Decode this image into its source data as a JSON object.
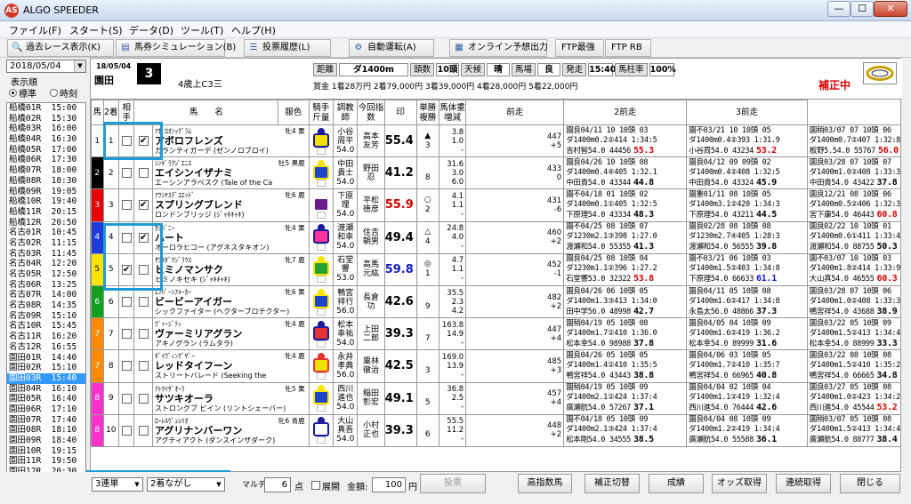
{
  "app": {
    "title": "ALGO SPEEDER",
    "logo": "AS"
  },
  "window": {
    "min": "—",
    "max": "☐",
    "close": "✕"
  },
  "menu": [
    "ファイル(F)",
    "スタート(S)",
    "データ(D)",
    "ツール(T)",
    "ヘルプ(H)"
  ],
  "toolbar": [
    {
      "label": "過去レース表示(K)",
      "icon": "search-icon"
    },
    {
      "label": "馬券シミュレーション(B)",
      "icon": "ticket-icon"
    },
    {
      "label": "投票履歴(L)",
      "icon": "list-icon"
    },
    {
      "label": "自動運転(A)",
      "icon": "gear-icon"
    },
    {
      "label": "オンライン予想出力",
      "icon": "output-icon"
    },
    {
      "label": "FTP最強"
    },
    {
      "label": "FTP RB"
    }
  ],
  "left": {
    "date": "2018/05/04",
    "order_label": "表示順",
    "radio": [
      {
        "label": "標準",
        "checked": true
      },
      {
        "label": "時刻",
        "checked": false
      }
    ],
    "races": [
      "船橋01R  15:00",
      "船橋02R  15:30",
      "船橋03R  16:00",
      "船橋04R  16:30",
      "船橋05R  17:00",
      "船橋06R  17:30",
      "船橋07R  18:00",
      "船橋08R  18:30",
      "船橋09R  19:05",
      "船橋10R  19:40",
      "船橋11R  20:15",
      "船橋12R  20:50",
      "名古01R  10:45",
      "名古02R  11:15",
      "名古03R  11:45",
      "名古04R  12:20",
      "名古05R  12:50",
      "名古06R  13:25",
      "名古07R  14:00",
      "名古08R  14:35",
      "名古09R  15:10",
      "名古10R  15:45",
      "名古11R  16:20",
      "名古12R  16:55",
      "園田01R  14:40",
      "園田02R  15:10",
      "園田03R  15:40",
      "園田04R  16:10",
      "園田05R  16:40",
      "園田06R  17:10",
      "園田07R  17:40",
      "園田08R  18:10",
      "園田09R  18:40",
      "園田10R  19:15",
      "園田11R  19:50",
      "園田12R  20:30"
    ],
    "selected_index": 26
  },
  "race": {
    "date": "18/05/04",
    "track": "園田",
    "number": "3",
    "class": "4歳上C3三",
    "info": [
      {
        "label": "距離",
        "value": "ダ1400m",
        "w": 78
      },
      {
        "label": "頭数",
        "value": "10頭",
        "w": 26
      },
      {
        "label": "天候",
        "value": "晴",
        "w": 26
      },
      {
        "label": "馬場",
        "value": "良",
        "w": 26
      },
      {
        "label": "発走",
        "value": "15:40",
        "w": 28
      },
      {
        "label": "馬柱率",
        "value": "100%",
        "w": 28
      }
    ],
    "prize": "賞金  1着28万円    2着79,000円    3着39,000円    4着28,000円    5着22,000円",
    "hosei": "補正中"
  },
  "columns": [
    "馬",
    "2着",
    "相手",
    "馬　　名",
    "",
    "服色",
    "騎手\n斤量",
    "調教師",
    "今回指数",
    "印",
    "単勝\n複勝",
    "馬体重\n増減",
    "前走",
    "2前走",
    "3前走"
  ],
  "horses": [
    {
      "waku": "1",
      "wcol": "#ffffff",
      "wtext": "#000",
      "num": "1",
      "c2": false,
      "aite": true,
      "top": "ｱﾎﾟﾛｵﾝｯｸﾞﾗﾑ",
      "sex": "牝4 栗",
      "name": "アポロフレンズ",
      "sire": "ガランティガーデ (ゼンノロブロイ)",
      "silk": [
        "#f2e000",
        "#1b1b9c"
      ],
      "jockey": "小谷\n周平\n54.0",
      "trainer": "高本\n友芳",
      "index": "55.4",
      "icol": "#000",
      "mark": "▲\n3",
      "odds": "3.8\n1.0\n-",
      "wt": "447\n+5",
      "p1": [
        "園良04/11  10 10頭 03",
        "ダ1400m0.2②414 1:34:5",
        "吉村智54.0 44456",
        {
          "v": "55.3",
          "c": "red"
        }
      ],
      "p2": [
        "園不03/21  10 10頭 05",
        "ダ1400m0.4②393 1:31.9",
        "小谷周54.0 43234",
        {
          "v": "53.2",
          "c": "red"
        }
      ],
      "p3": [
        "園稍03/07  07 10頭 06",
        "ダ1400m0.7②407 1:32:8",
        "板野5.54.0 55767",
        {
          "v": "56.0",
          "c": "red"
        }
      ]
    },
    {
      "waku": "2",
      "wcol": "#000000",
      "wtext": "#fff",
      "num": "2",
      "c2": false,
      "aite": false,
      "top": "ｼﾝｷﾞﾗｸｼﾞｴﾆｽ",
      "sex": "牡5 黒鹿",
      "name": "エイシンイザナミ",
      "sire": "エーシンアラベスク (Tale of the Ca",
      "silk": [
        "#1e46c8",
        "#f2e000"
      ],
      "jockey": "中田\n貴士\n54.0",
      "trainer": "野田\n忍",
      "index": "41.2",
      "icol": "#000",
      "mark": "\n8",
      "odds": "31.6\n3.0\n6.0",
      "wt": "433\n0",
      "p1": [
        "園良04/26  10 10頭 08",
        "ダ1400m0.4④405 1:32.1",
        "中田貴54.0 43344",
        {
          "v": "44.8",
          "c": "b"
        }
      ],
      "p2": [
        "園良04/12  09 09頭 02",
        "ダ1400m0.4②408 1:32:5",
        "中田貴54.0 43324",
        {
          "v": "45.9",
          "c": "b"
        }
      ],
      "p3": [
        "園良03/28  07 10頭 07",
        "ダ1400m1.0②408 1:33:3",
        "中田貴54.0 43422",
        {
          "v": "37.8",
          "c": "b"
        }
      ]
    },
    {
      "waku": "3",
      "wcol": "#e60000",
      "wtext": "#fff",
      "num": "3",
      "c2": false,
      "aite": true,
      "top": "ｱﾜｼﾔｽﾃﾞﾕｴｯﾄﾞ",
      "sex": "牝6 鹿",
      "name": "スプリングブレンド",
      "sire": "ロンドンブリッジ (ｼﾞｬｷｷｬｷ)",
      "silk": [
        "#6a1d8a",
        "#ffffff"
      ],
      "jockey": "下原\n理\n54.0",
      "trainer": "平松\n徳彦",
      "index": "55.9",
      "icol": "#d40000",
      "mark": "○\n2",
      "odds": "4.1\n1.1\n-",
      "wt": "431\n-6",
      "p1": [
        "園不04/18  01 10頭 02",
        "ダ1400m0.1①405 1:32:5",
        "下原理54.0 43334",
        {
          "v": "48.3",
          "c": "b"
        }
      ],
      "p2": [
        "園重01/11  08 10頭 05",
        "ダ1400m3.1②420 1:34:3",
        "下原理54.0 43211",
        {
          "v": "44.5",
          "c": "b"
        }
      ],
      "p3": [
        "園良12/21  08 10頭 06",
        "ダ1400m0.5②406 1:32:3",
        "宮下康54.0 46443",
        {
          "v": "60.8",
          "c": "red"
        }
      ]
    },
    {
      "waku": "4",
      "wcol": "#1e3cd8",
      "wtext": "#fff",
      "num": "4",
      "c2": false,
      "aite": true,
      "top": "ｶｯﾊﾞﾆｰ",
      "sex": "牝4 栗",
      "name": "ハート",
      "sire": "オーロラヒコー (アグネスタキオン)",
      "silk": [
        "#ff3399",
        "#1b1b9c"
      ],
      "jockey": "渡瀬\n和幸\n54.0",
      "trainer": "住吉\n朝男",
      "index": "49.4",
      "icol": "#000",
      "mark": "△\n4",
      "odds": "24.8\n4.0\n-",
      "wt": "460\n+2",
      "p1": [
        "園不04/25  08 10頭 07",
        "ダ1230m2.1③398 1:27.0",
        "渡瀬和54.0 55355",
        {
          "v": "41.3",
          "c": "b"
        }
      ],
      "p2": [
        "園良02/28  08 10頭 08",
        "ダ1230m2.7④405 1:28:3",
        "渡瀬和54.0 56555",
        {
          "v": "39.8",
          "c": "b"
        }
      ],
      "p3": [
        "園良02/22  10 10頭 01",
        "ダ1400m0.6①411 1:33:4",
        "渡瀬和54.0 88755",
        {
          "v": "50.3",
          "c": "b"
        }
      ]
    },
    {
      "waku": "5",
      "wcol": "#ffe400",
      "wtext": "#000",
      "num": "5",
      "c2": true,
      "aite": false,
      "top": "ｻﾜｽﾀﾞﾏｼﾞﾗｳｽ",
      "sex": "牝7 鹿",
      "name": "ヒミノマンサク",
      "sire": "ヒミノキセキ (ｼﾞｬｷｷｬｷ)",
      "silk": [
        "#23a033",
        "#ffe400"
      ],
      "jockey": "石堂\n響\n53.0",
      "trainer": "高馬\n元紘",
      "index": "59.8",
      "icol": "#1020c0",
      "mark": "◎\n1",
      "odds": "4.7\n1.1\n-",
      "wt": "452\n-1",
      "p1": [
        "園良04/25  08 10頭 04",
        "ダ1230m1.1②396 1:27.2",
        "石堂響53.0 32322",
        {
          "v": "53.8",
          "c": "red"
        }
      ],
      "p2": [
        "園不03/21  06 10頭 03",
        "ダ1400m1.5②403 1:34:8",
        "下原理54.0 66633",
        {
          "v": "61.1",
          "c": "blue"
        }
      ],
      "p3": [
        "園不03/07  10 10頭 03",
        "ダ1400m1.8②414 1:33:9",
        "大山真54.0 46555",
        {
          "v": "60.3",
          "c": "red"
        }
      ]
    },
    {
      "waku": "6",
      "wcol": "#13a01f",
      "wtext": "#fff",
      "num": "6",
      "c2": false,
      "aite": false,
      "top": "ｴﾝﾊﾞｰｼｱﾒｰｶｰ",
      "sex": "牝6 栗",
      "name": "ビービーアイガー",
      "sire": "シックファイター (ヘクターブロテクター)",
      "silk": [
        "#1e46c8",
        "#ffe400"
      ],
      "jockey": "鴨宮\n祥行\n56.0",
      "trainer": "長倉\n功",
      "index": "42.6",
      "icol": "#000",
      "mark": "\n9",
      "odds": "35.5\n2.3\n4.2",
      "wt": "482\n+2",
      "p1": [
        "園良04/26  06 10頭 05",
        "ダ1400m1.3③413 1:34:0",
        "田中学56.0 48998",
        {
          "v": "42.7",
          "c": "b"
        }
      ],
      "p2": [
        "園良04/11  05 10頭 08",
        "ダ1400m1.6②417 1:34:8",
        "永島太56.0 48866",
        {
          "v": "37.3",
          "c": "b"
        }
      ],
      "p3": [
        "園良03/28  07 10頭 06",
        "ダ1400m1.0②408 1:33:3",
        "鴨宮祥54.0 43688",
        {
          "v": "38.9",
          "c": "b"
        }
      ]
    },
    {
      "waku": "7",
      "wcol": "#ff8a00",
      "wtext": "#fff",
      "num": "7",
      "c2": false,
      "aite": false,
      "top": "ｳﾞｧｰｼﾞﾃｨ",
      "sex": "牝4 鹿",
      "name": "ヴァーミリアグラン",
      "sire": "アキノグラン (ラムタラ)",
      "silk": [
        "#e53333",
        "#1b1b9c"
      ],
      "jockey": "松本\n幸祐\n54.0",
      "trainer": "上田\n二郎",
      "index": "39.3",
      "icol": "#000",
      "mark": "\n7",
      "odds": "163.8\n14.9\n-",
      "wt": "447\n+4",
      "p1": [
        "園稍04/19  05 10頭 08",
        "ダ1400m1.7②410 1:36.0",
        "松本幸54.0 98988",
        {
          "v": "37.8",
          "c": "b"
        }
      ],
      "p2": [
        "園良04/05  04 10頭 09",
        "ダ1400m1.6②419 1:36.2",
        "松本幸54.0 89999",
        {
          "v": "31.6",
          "c": "b"
        }
      ],
      "p3": [
        "園良03/22  05 10頭 09",
        "ダ1400m1.5②413 1:34:4",
        "松本幸54.0 88999",
        {
          "v": "33.3",
          "c": "b"
        }
      ]
    },
    {
      "waku": "7",
      "wcol": "#ff8a00",
      "wtext": "#fff",
      "num": "8",
      "c2": false,
      "aite": false,
      "top": "ﾀﾞｲｳﾞｨﾝｸﾞｻﾞｰ",
      "sex": "牝4 鹿",
      "name": "レッドタイフーン",
      "sire": "ストリートバレード (Seeking the",
      "silk": [
        "#f2e000",
        "#e53333"
      ],
      "jockey": "永井\n孝典\n56.0",
      "trainer": "粟林\n徹治",
      "index": "42.5",
      "icol": "#000",
      "mark": "\n3",
      "odds": "169.0\n13.9\n-",
      "wt": "485\n+3",
      "p1": [
        "園良04/26  05 10頭 05",
        "ダ1400m1.4②410 1:35:5",
        "鴨宮祥54.0 43443",
        {
          "v": "38.8",
          "c": "b"
        }
      ],
      "p2": [
        "園良04/06  03 10頭 05",
        "ダ1400m1.7②410 1:35:7",
        "鴨宮祥54.0 66965",
        {
          "v": "40.8",
          "c": "b"
        }
      ],
      "p3": [
        "園良03/22  08 10頭 08",
        "ダ1400m1.5②410 1:35:2",
        "鴨宮祥54.0 66665",
        {
          "v": "34.8",
          "c": "b"
        }
      ]
    },
    {
      "waku": "8",
      "wcol": "#ff33cc",
      "wtext": "#fff",
      "num": "9",
      "c2": false,
      "aite": false,
      "top": "ｱﾄﾏｲｻﾞｵｰﾗ",
      "sex": "牝5 栗",
      "name": "サツキオーラ",
      "sire": "ストロングブ ビイン (リントシェーバー)",
      "silk": [
        "#1e46c8",
        "#ffe400"
      ],
      "jockey": "西川\n進也\n54.0",
      "trainer": "稲田\n彰宏",
      "index": "49.1",
      "icol": "#000",
      "mark": "\n5",
      "odds": "36.8\n2.5\n-",
      "wt": "457\n+4",
      "p1": [
        "園稍04/19  05 10頭 09",
        "ダ1400m2.1②424 1:37:4",
        "廣瀬航54.0 57267",
        {
          "v": "37.1",
          "c": "b"
        }
      ],
      "p2": [
        "園良04/04  02 10頭 04",
        "ダ1400m1.1②419 1:32:4",
        "西川進54.0 76444",
        {
          "v": "42.6",
          "c": "b"
        }
      ],
      "p3": [
        "園良03/27  05 10頭 08",
        "ダ1400m1.0②423 1:34:2",
        "西川進54.0 45544",
        {
          "v": "53.2",
          "c": "red"
        }
      ]
    },
    {
      "waku": "8",
      "wcol": "#ff33cc",
      "wtext": "#fff",
      "num": "10",
      "c2": false,
      "aite": false,
      "top": "ﾛｰﾚﾙｳﾞｪﾚﾘｵ",
      "sex": "牝6 青鹿",
      "name": "アグリナンバーワン",
      "sire": "アグティアクト (ダンスインザダーク)",
      "silk": [
        "#ffffff",
        "#1b1b9c"
      ],
      "jockey": "大山\n真吾\n54.0",
      "trainer": "小村\n正也",
      "index": "39.3",
      "icol": "#000",
      "mark": "\n6",
      "odds": "55.5\n11.2\n-",
      "wt": "448\n+2",
      "p1": [
        "園不04/18  05 10頭 09",
        "ダ1400m2.1③424 1:37:4",
        "松本剛54.0 34555",
        {
          "v": "38.5",
          "c": "b"
        }
      ],
      "p2": [
        "園良04/04  08 10頭 09",
        "ダ1400m1.2②419 1:34:4",
        "廣瀬航54.0 55588",
        {
          "v": "36.1",
          "c": "b"
        }
      ],
      "p3": [
        "園稍03/07  05 10頭 08",
        "ダ1400m1.5②413 1:34:4",
        "廣瀬航54.0 88777",
        {
          "v": "38.4",
          "c": "b"
        }
      ]
    }
  ],
  "bottom": {
    "bet_type": "3連単",
    "mode": "2着ながし",
    "maruchi": "マルチ",
    "points": "6",
    "points_unit": "点",
    "tenkai": "展開",
    "amount_label": "金額:",
    "amount": "100",
    "yen": "円",
    "buttons": [
      "投票",
      "高指数馬",
      "補正切替",
      "成績",
      "オッズ取得",
      "連続取得",
      "閉じる"
    ]
  }
}
